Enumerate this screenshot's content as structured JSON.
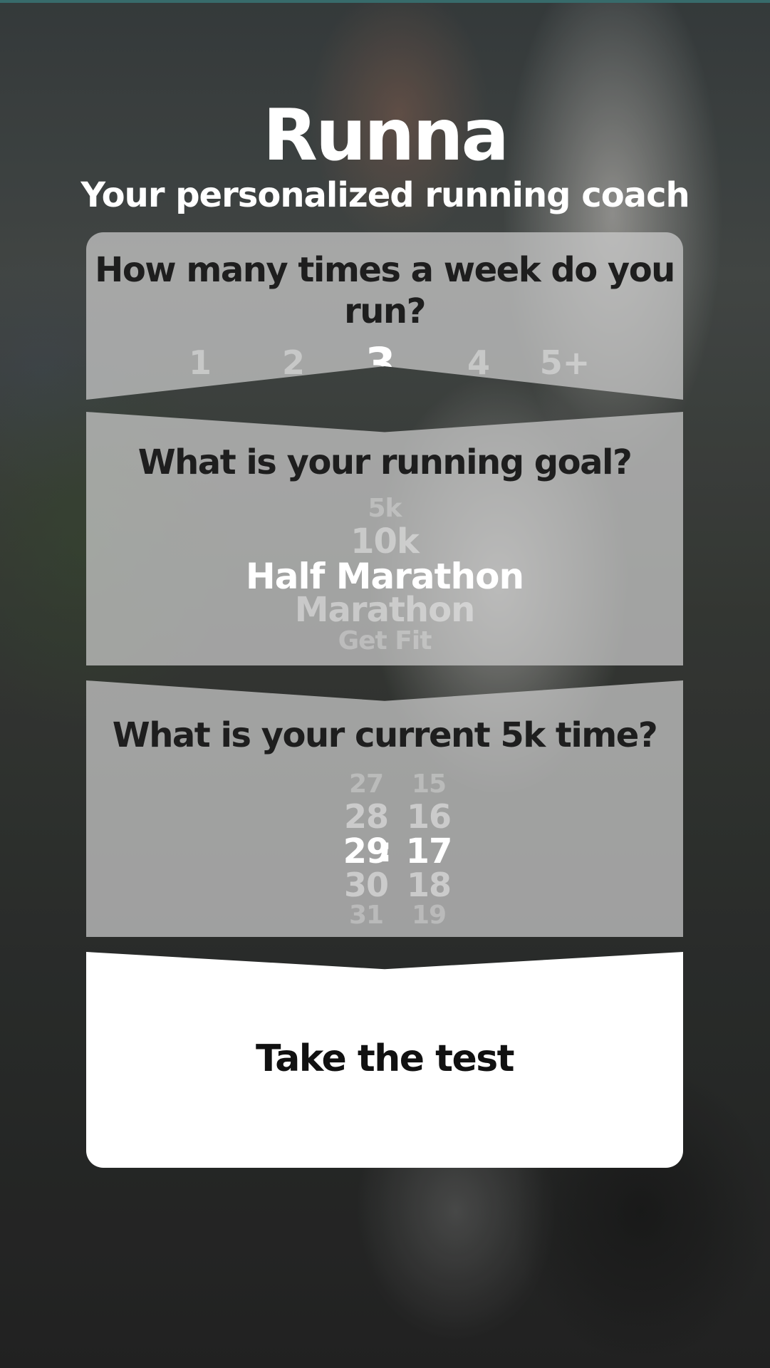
{
  "app": {
    "logo_text": "Runna",
    "tagline": "Your personalized running coach"
  },
  "frequency": {
    "question": "How many times a week do you run?",
    "options": [
      "1",
      "2",
      "3",
      "4",
      "5+"
    ],
    "selected": "3"
  },
  "goal": {
    "question": "What is your running goal?",
    "options": [
      "5k",
      "10k",
      "Half Marathon",
      "Marathon",
      "Get Fit"
    ],
    "selected": "Half Marathon"
  },
  "current_time": {
    "question": "What is your current 5k time?",
    "minutes": [
      "27",
      "28",
      "29",
      "30",
      "31"
    ],
    "seconds": [
      "15",
      "16",
      "17",
      "18",
      "19"
    ],
    "separator": ":",
    "selected_minutes": "29",
    "selected_seconds": "17"
  },
  "cta": {
    "label": "Take the test"
  },
  "colors": {
    "card_bg": "#cdcdcd",
    "cta_bg": "#ffffff",
    "text_dark": "#1e1e1e",
    "accent_top": "#3f7a7a"
  }
}
